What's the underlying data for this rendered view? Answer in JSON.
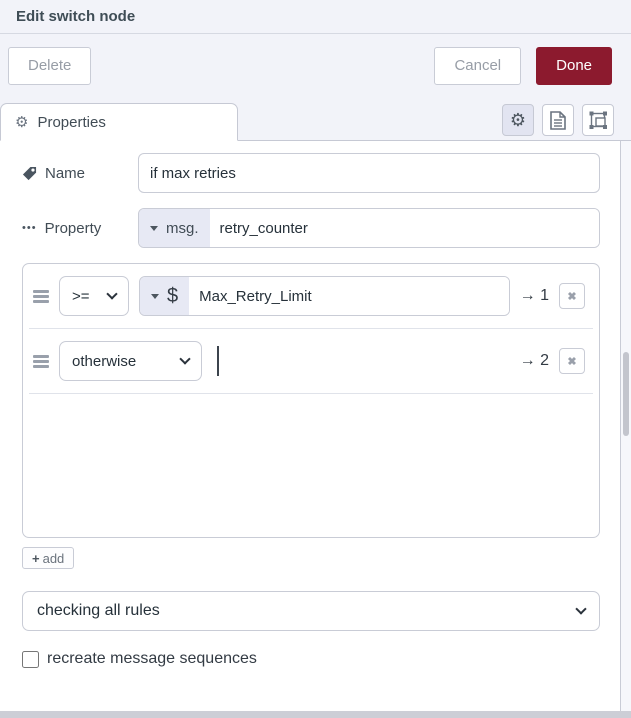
{
  "dialog": {
    "title": "Edit switch node"
  },
  "toolbar": {
    "delete_label": "Delete",
    "cancel_label": "Cancel",
    "done_label": "Done"
  },
  "tabs": {
    "properties_label": "Properties"
  },
  "icons": {
    "gear_glyph": "⚙",
    "ellipsis_glyph": "•••",
    "remove_glyph": "✖",
    "add_plus_glyph": "+"
  },
  "form": {
    "name": {
      "label": "Name",
      "value": "if max retries"
    },
    "property": {
      "label": "Property",
      "prefix": "msg.",
      "value": "retry_counter"
    }
  },
  "rules": [
    {
      "operator": ">=",
      "value_type": "$",
      "value": "Max_Retry_Limit",
      "arrow": "→",
      "output": "→ 1"
    },
    {
      "operator": "otherwise",
      "arrow": "→",
      "output": "→ 2"
    }
  ],
  "footer": {
    "add_label": "add",
    "check_mode_value": "checking all rules",
    "checkbox_label": "recreate message sequences",
    "checkbox_checked": false
  },
  "colors": {
    "accent_red": "#8c1a2e",
    "panel_bg": "#f2f3f9"
  }
}
